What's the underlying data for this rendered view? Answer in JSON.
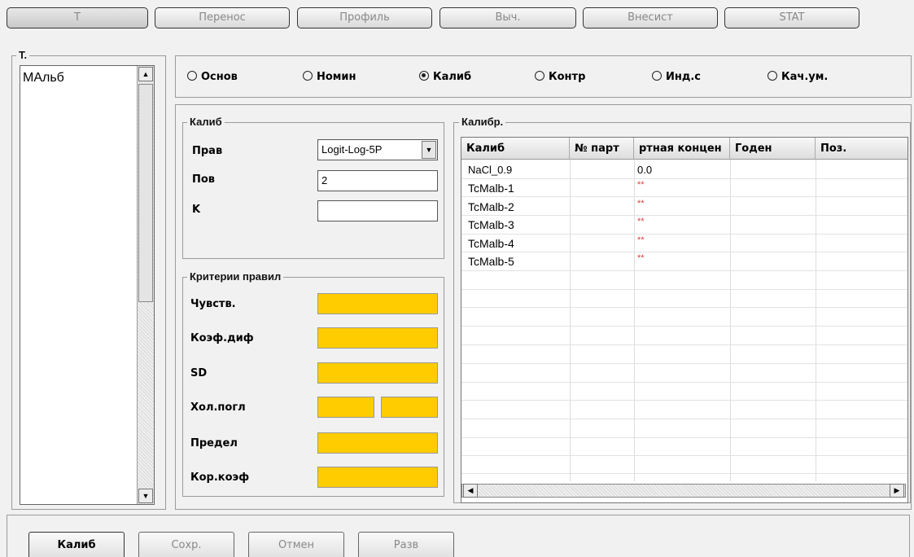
{
  "tabs": [
    {
      "label": "T"
    },
    {
      "label": "Перенос"
    },
    {
      "label": "Профиль"
    },
    {
      "label": "Выч."
    },
    {
      "label": "Внесист"
    },
    {
      "label": "STAT"
    }
  ],
  "left_panel": {
    "legend": "Т.",
    "items": [
      "МАльб"
    ]
  },
  "modes": [
    {
      "label": "Основ",
      "selected": false
    },
    {
      "label": "Номин",
      "selected": false
    },
    {
      "label": "Калиб",
      "selected": true
    },
    {
      "label": "Контр",
      "selected": false
    },
    {
      "label": "Инд.с",
      "selected": false
    },
    {
      "label": "Кач.ум.",
      "selected": false
    }
  ],
  "calib_group": {
    "legend": "Калиб",
    "rule_label": "Прав",
    "rule_value": "Logit-Log-5P",
    "repeat_label": "Пов",
    "repeat_value": "2",
    "k_label": "K",
    "k_value": ""
  },
  "criteria_group": {
    "legend": "Критерии правил",
    "labels": [
      "Чувств.",
      "Коэф.диф",
      "SD",
      "Хол.погл",
      "Предел",
      "Кор.коэф"
    ]
  },
  "calib_table": {
    "legend": "Калибр.",
    "columns": [
      "Калиб",
      "№ парт",
      "ртная концен",
      "Годен",
      "Поз."
    ],
    "rows": [
      {
        "name": "NaCl_0.9",
        "conc": "0.0"
      },
      {
        "name": "TcMalb-1",
        "conc": "**"
      },
      {
        "name": "TcMalb-2",
        "conc": "**"
      },
      {
        "name": "TcMalb-3",
        "conc": "**"
      },
      {
        "name": "TcMalb-4",
        "conc": "**"
      },
      {
        "name": "TcMalb-5",
        "conc": "**"
      }
    ]
  },
  "buttons": {
    "calib": "Калиб",
    "save": "Сохр.",
    "cancel": "Отмен",
    "expand": "Разв"
  },
  "colors": {
    "criteria_field": "#ffcc00",
    "conc_placeholder": "#e23b3b"
  }
}
